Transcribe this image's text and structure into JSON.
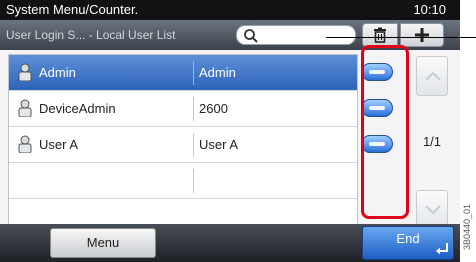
{
  "header": {
    "title": "System Menu/Counter.",
    "time": "10:10",
    "subtitle": "User Login S... - Local User List"
  },
  "toolbar": {
    "search_icon": "search-icon",
    "trash_icon": "trash-icon",
    "plus_icon": "plus-icon"
  },
  "users": [
    {
      "name": "Admin",
      "login": "Admin",
      "selected": true
    },
    {
      "name": "DeviceAdmin",
      "login": "2600",
      "selected": false
    },
    {
      "name": "User A",
      "login": "User A",
      "selected": false
    },
    {
      "name": "",
      "login": "",
      "selected": false
    }
  ],
  "pager": {
    "page": "1/1"
  },
  "footer": {
    "menu_label": "Menu",
    "end_label": "End"
  },
  "ref_code": "3B0440_01",
  "colors": {
    "selected_row": "#3a71c6",
    "highlight": "#e0001a",
    "end_button": "#2a6fd2"
  }
}
